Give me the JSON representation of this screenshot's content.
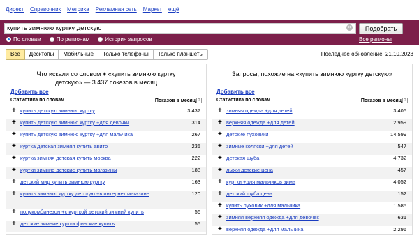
{
  "topnav": [
    "Директ",
    "Справочник",
    "Метрика",
    "Рекламная сеть",
    "Маркет",
    "ещё"
  ],
  "search": {
    "value": "купить зимнюю куртку детскую",
    "button": "Подобрать",
    "modes": [
      "По словам",
      "По регионам",
      "История запросов"
    ],
    "selected_mode": "По словам",
    "regions": "Все регионы"
  },
  "tabs": [
    "Все",
    "Десктопы",
    "Мобильные",
    "Только телефоны",
    "Только планшеты"
  ],
  "active_tab": "Все",
  "updated": "Последнее обновление: 21.10.2023",
  "left": {
    "title_a": "Что искали со словом",
    "title_b": "«купить зимнюю куртку",
    "title_c": "детскую» — 3 437 показов в месяц",
    "add_all": "Добавить все",
    "col_phrase": "Статистика по словам",
    "col_count": "Показов в месяц",
    "rows": [
      {
        "phrase": "купить детскую зимнюю куртку",
        "count": "3 437"
      },
      {
        "phrase": "купить детскую зимнюю куртку +для девочки",
        "count": "314"
      },
      {
        "phrase": "купить детскую зимнюю куртку +для мальчика",
        "count": "267"
      },
      {
        "phrase": "куртка детская зимняя купить авито",
        "count": "235"
      },
      {
        "phrase": "куртка зимняя детская купить москва",
        "count": "222"
      },
      {
        "phrase": "куртки зимние детские купить магазины",
        "count": "188"
      },
      {
        "phrase": "детский мир купить зимнюю куртку",
        "count": "163"
      },
      {
        "phrase": "купить зимнюю куртку детскую +в интернет магазине",
        "count": "120"
      },
      {
        "phrase": "полукомбинезон +с курткой детский зимний купить",
        "count": "56"
      },
      {
        "phrase": "детские зимние куртки финские купить",
        "count": "55"
      }
    ]
  },
  "right": {
    "title": "Запросы, похожие на «купить зимнюю куртку детскую»",
    "add_all": "Добавить все",
    "col_phrase": "Статистика по словам",
    "col_count": "Показов в месяц",
    "rows": [
      {
        "phrase": "зимняя одежда +для детей",
        "count": "3 405"
      },
      {
        "phrase": "верхняя одежда +для детей",
        "count": "2 959"
      },
      {
        "phrase": "детские пуховики",
        "count": "14 599"
      },
      {
        "phrase": "зимние коляски +для детей",
        "count": "547"
      },
      {
        "phrase": "детская шуба",
        "count": "4 732"
      },
      {
        "phrase": "лыжи детские цена",
        "count": "457"
      },
      {
        "phrase": "куртки +для мальчиков зима",
        "count": "4 052"
      },
      {
        "phrase": "детский шуба цена",
        "count": "152"
      },
      {
        "phrase": "купить пуховик +для мальчика",
        "count": "1 585"
      },
      {
        "phrase": "зимняя верхняя одежда +для девочек",
        "count": "631"
      },
      {
        "phrase": "верхняя одежда +для мальчика",
        "count": "2 296"
      }
    ]
  },
  "colors": {
    "band": "#7c1f4a",
    "link": "#1a3dc1",
    "active_tab": "#ffeba0"
  }
}
